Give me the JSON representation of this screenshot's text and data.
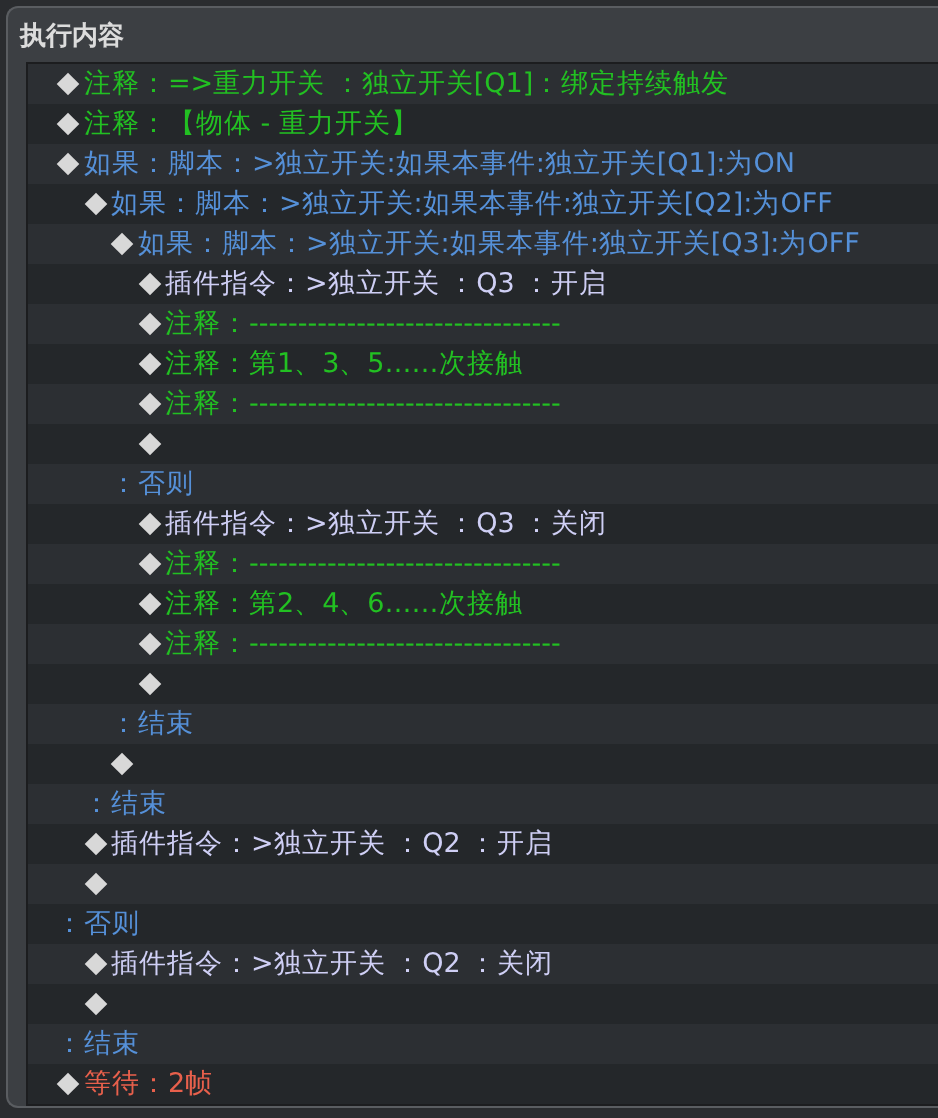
{
  "panel": {
    "title": "执行内容"
  },
  "commands": [
    {
      "kind": "comment",
      "text": "注释：=>重力开关 ：独立开关[Q1]：绑定持续触发"
    },
    {
      "kind": "comment",
      "text": "注释：【物体 - 重力开关】"
    },
    {
      "kind": "branch",
      "text": "如果：脚本：>独立开关:如果本事件:独立开关[Q1]:为ON",
      "children": [
        {
          "kind": "branch",
          "text": "如果：脚本：>独立开关:如果本事件:独立开关[Q2]:为OFF",
          "children": [
            {
              "kind": "branch",
              "text": "如果：脚本：>独立开关:如果本事件:独立开关[Q3]:为OFF",
              "children": [
                {
                  "kind": "plugin",
                  "text": "插件指令：>独立开关 ：Q3 ：开启"
                },
                {
                  "kind": "comment",
                  "text": "注释：--------------------------------"
                },
                {
                  "kind": "comment",
                  "text": "注释：第1、3、5……次接触"
                },
                {
                  "kind": "comment",
                  "text": "注释：--------------------------------"
                },
                {
                  "kind": "empty"
                }
              ]
            },
            {
              "kind": "else",
              "text": "：否则",
              "children": [
                {
                  "kind": "plugin",
                  "text": "插件指令：>独立开关 ：Q3 ：关闭"
                },
                {
                  "kind": "comment",
                  "text": "注释：--------------------------------"
                },
                {
                  "kind": "comment",
                  "text": "注释：第2、4、6……次接触"
                },
                {
                  "kind": "comment",
                  "text": "注释：--------------------------------"
                },
                {
                  "kind": "empty"
                }
              ]
            },
            {
              "kind": "end",
              "text": "：结束"
            },
            {
              "kind": "empty"
            }
          ]
        },
        {
          "kind": "end",
          "text": "：结束"
        },
        {
          "kind": "plugin",
          "text": "插件指令：>独立开关 ：Q2 ：开启"
        },
        {
          "kind": "empty"
        }
      ]
    },
    {
      "kind": "else",
      "text": "：否则",
      "children": [
        {
          "kind": "plugin",
          "text": "插件指令：>独立开关 ：Q2 ：关闭"
        },
        {
          "kind": "empty"
        }
      ]
    },
    {
      "kind": "end",
      "text": "：结束"
    },
    {
      "kind": "wait",
      "text": "等待：2帧"
    }
  ]
}
